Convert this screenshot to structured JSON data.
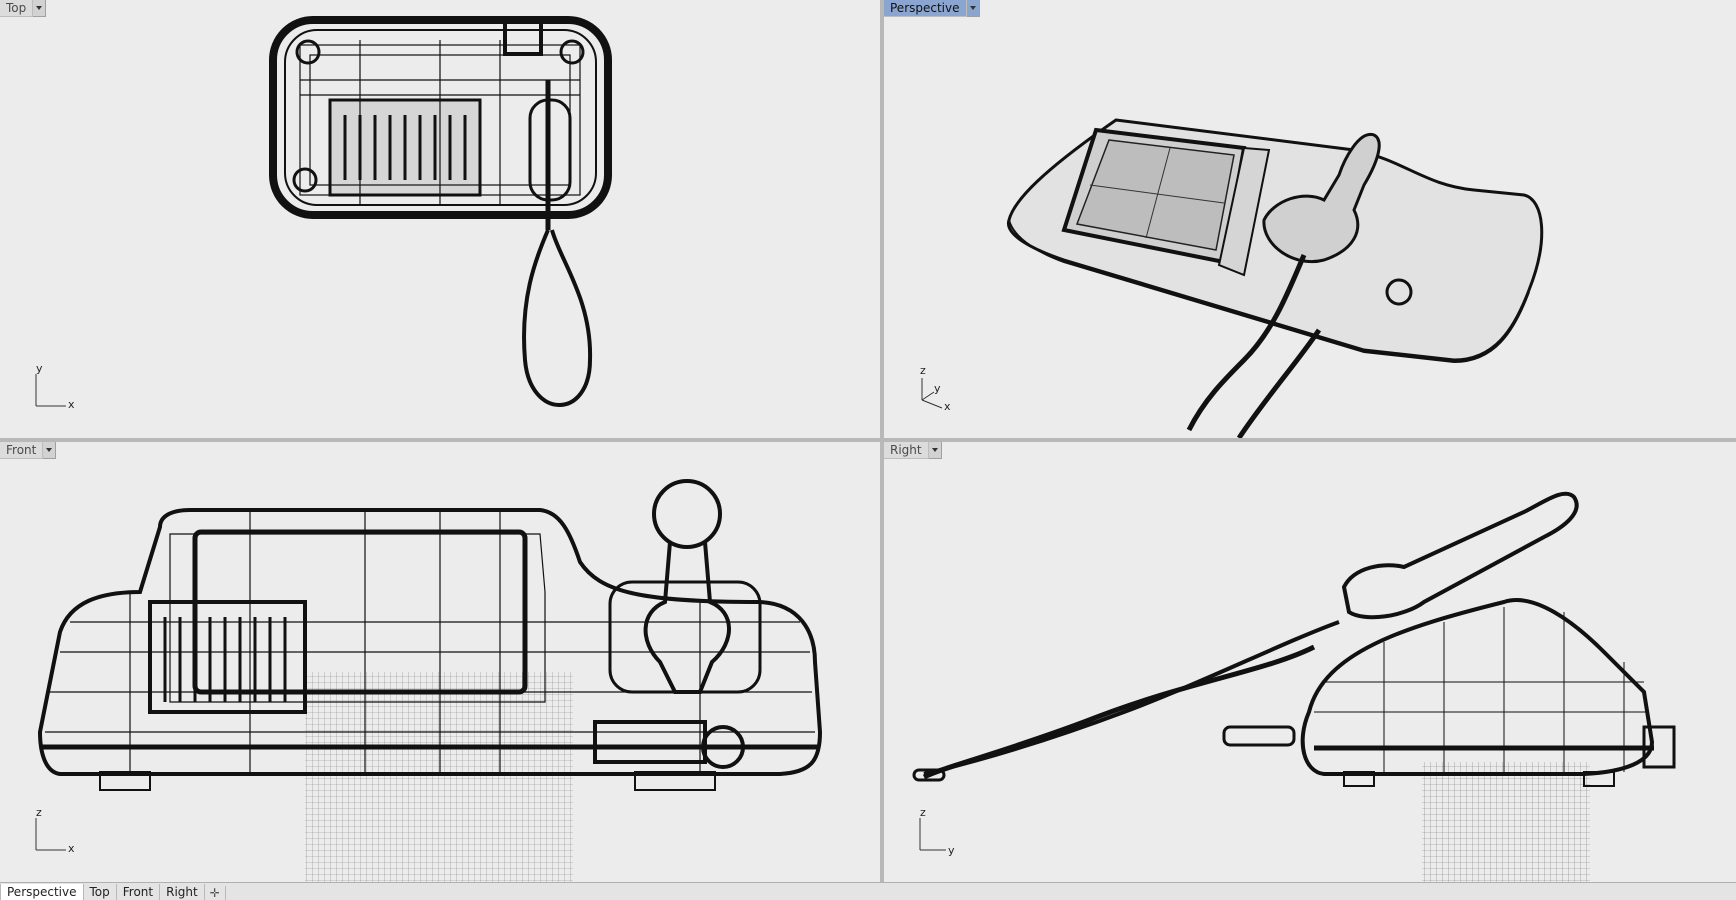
{
  "viewports": {
    "top": {
      "label": "Top",
      "axis_h": "x",
      "axis_v": "y"
    },
    "perspective": {
      "label": "Perspective",
      "axis_1": "z",
      "axis_2": "y",
      "axis_3": "x"
    },
    "front": {
      "label": "Front",
      "axis_h": "x",
      "axis_v": "z"
    },
    "right": {
      "label": "Right",
      "axis_h": "y",
      "axis_v": "z"
    }
  },
  "tabs": [
    {
      "label": "Perspective",
      "active": true
    },
    {
      "label": "Top"
    },
    {
      "label": "Front"
    },
    {
      "label": "Right"
    }
  ],
  "tab_add_icon": "plus-icon",
  "colors": {
    "viewport_bg": "#ececec",
    "active_label": "#8aa6d0",
    "wire": "#111111"
  }
}
